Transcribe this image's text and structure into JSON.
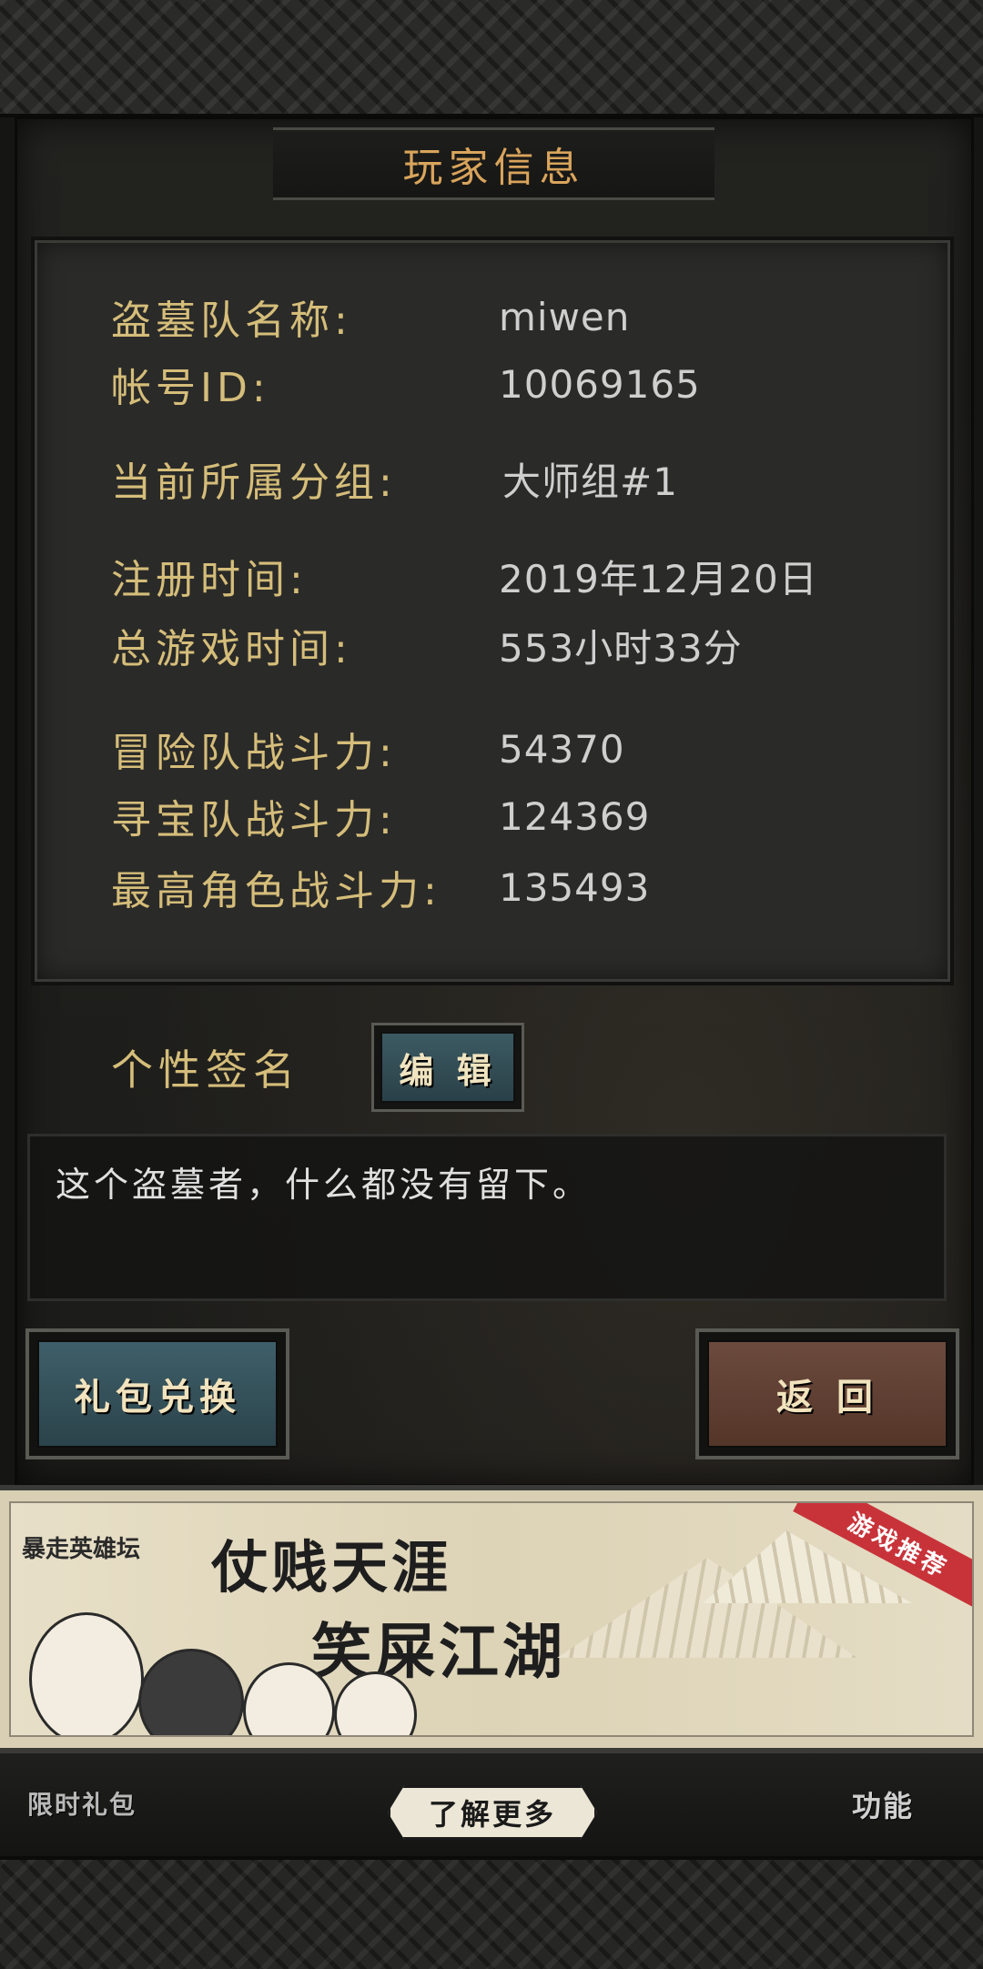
{
  "title": "玩家信息",
  "info": {
    "team_name_label": "盗墓队名称:",
    "team_name_value": "miwen",
    "account_id_label": "帐号ID:",
    "account_id_value": "10069165",
    "group_label": "当前所属分组:",
    "group_value": "大师组#1",
    "register_label": "注册时间:",
    "register_value": "2019年12月20日",
    "play_time_label": "总游戏时间:",
    "play_time_value": "553小时33分",
    "adventure_power_label": "冒险队战斗力:",
    "adventure_power_value": "54370",
    "treasure_power_label": "寻宝队战斗力:",
    "treasure_power_value": "124369",
    "top_role_power_label": "最高角色战斗力:",
    "top_role_power_value": "135493"
  },
  "signature": {
    "label": "个性签名",
    "edit_button": "编 辑",
    "text": "这个盗墓者，什么都没有留下。"
  },
  "buttons": {
    "gift_exchange": "礼包兑换",
    "back": "返 回"
  },
  "ad": {
    "logo": "暴走英雄坛",
    "line1": "仗贱天涯",
    "line2": "笑屎江湖",
    "tag": "游戏推荐",
    "learn_more": "了解更多"
  },
  "bottom_nav": {
    "left": "限时礼包",
    "right": "功能"
  }
}
